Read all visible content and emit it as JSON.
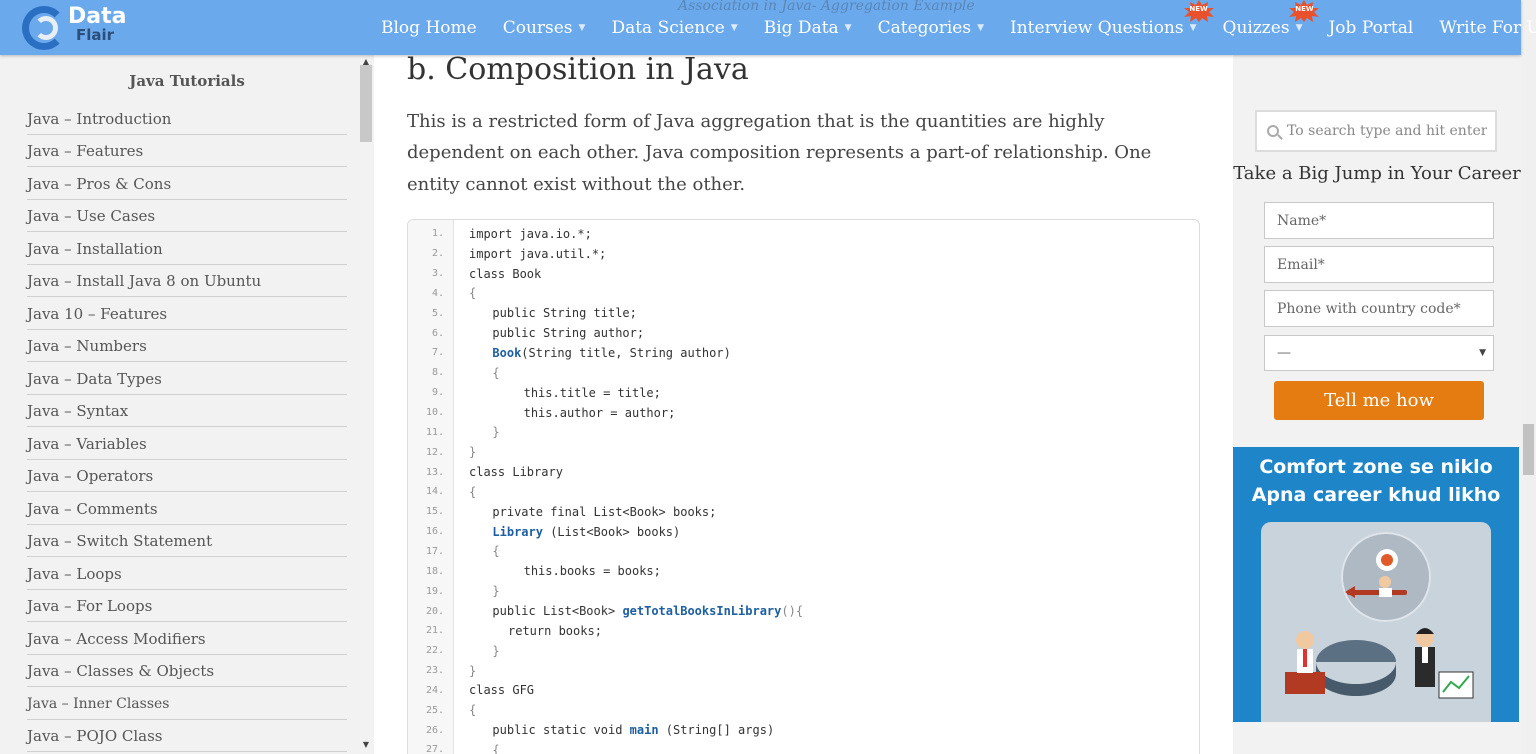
{
  "header": {
    "logo_line1": "Data",
    "logo_line2": "Flair",
    "ghost_text": "Association in Java- Aggregation Example",
    "badge_text": "NEW",
    "menu": [
      {
        "label": "Blog Home",
        "caret": false,
        "badge": false
      },
      {
        "label": "Courses",
        "caret": true,
        "badge": false
      },
      {
        "label": "Data Science",
        "caret": true,
        "badge": false
      },
      {
        "label": "Big Data",
        "caret": true,
        "badge": false
      },
      {
        "label": "Categories",
        "caret": true,
        "badge": false
      },
      {
        "label": "Interview Questions",
        "caret": true,
        "badge": true
      },
      {
        "label": "Quizzes",
        "caret": true,
        "badge": true
      },
      {
        "label": "Job Portal",
        "caret": false,
        "badge": false
      },
      {
        "label": "Write For Us",
        "caret": false,
        "badge": false
      }
    ]
  },
  "sidebar": {
    "title": "Java Tutorials",
    "items": [
      "Java – Introduction",
      "Java – Features",
      "Java – Pros & Cons",
      "Java – Use Cases",
      "Java – Installation",
      "Java – Install Java 8 on Ubuntu",
      "Java 10 – Features",
      "Java – Numbers",
      "Java – Data Types",
      "Java – Syntax",
      "Java – Variables",
      "Java – Operators",
      "Java – Comments",
      "Java – Switch Statement",
      "Java – Loops",
      "Java – For Loops",
      "Java – Access Modifiers",
      "Java – Classes & Objects",
      "Java – Inner Classes",
      "Java – POJO Class"
    ]
  },
  "article": {
    "heading": "b. Composition in Java",
    "paragraph": "This is a restricted form of Java aggregation that is the quantities are highly dependent on each other. Java composition represents a part-of relationship. One entity cannot exist without the other.",
    "code_lines": [
      {
        "n": "1.",
        "indent": 0,
        "parts": [
          [
            "import java.io.*;",
            ""
          ]
        ]
      },
      {
        "n": "2.",
        "indent": 0,
        "parts": [
          [
            "import java.util.*;",
            ""
          ]
        ]
      },
      {
        "n": "3.",
        "indent": 0,
        "parts": [
          [
            "class Book",
            ""
          ]
        ]
      },
      {
        "n": "4.",
        "indent": 0,
        "parts": [
          [
            "{",
            "dim"
          ]
        ]
      },
      {
        "n": "5.",
        "indent": 3,
        "parts": [
          [
            "public String title;",
            ""
          ]
        ]
      },
      {
        "n": "6.",
        "indent": 3,
        "parts": [
          [
            "public String author;",
            ""
          ]
        ]
      },
      {
        "n": "7.",
        "indent": 3,
        "parts": [
          [
            "Book",
            "kw"
          ],
          [
            "(String title, String author)",
            ""
          ]
        ]
      },
      {
        "n": "8.",
        "indent": 3,
        "parts": [
          [
            "{",
            "dim"
          ]
        ]
      },
      {
        "n": "9.",
        "indent": 7,
        "parts": [
          [
            "this.title = title;",
            ""
          ]
        ]
      },
      {
        "n": "10.",
        "indent": 7,
        "parts": [
          [
            "this.author = author;",
            ""
          ]
        ]
      },
      {
        "n": "11.",
        "indent": 3,
        "parts": [
          [
            "}",
            "dim"
          ]
        ]
      },
      {
        "n": "12.",
        "indent": 0,
        "parts": [
          [
            "}",
            "dim"
          ]
        ]
      },
      {
        "n": "13.",
        "indent": 0,
        "parts": [
          [
            "class Library",
            ""
          ]
        ]
      },
      {
        "n": "14.",
        "indent": 0,
        "parts": [
          [
            "{",
            "dim"
          ]
        ]
      },
      {
        "n": "15.",
        "indent": 3,
        "parts": [
          [
            "private final List<Book> books;",
            ""
          ]
        ]
      },
      {
        "n": "16.",
        "indent": 3,
        "parts": [
          [
            "Library",
            "kw"
          ],
          [
            " (List<Book> books)",
            ""
          ]
        ]
      },
      {
        "n": "17.",
        "indent": 3,
        "parts": [
          [
            "{",
            "dim"
          ]
        ]
      },
      {
        "n": "18.",
        "indent": 7,
        "parts": [
          [
            "this.books = books;",
            ""
          ]
        ]
      },
      {
        "n": "19.",
        "indent": 3,
        "parts": [
          [
            "}",
            "dim"
          ]
        ]
      },
      {
        "n": "20.",
        "indent": 3,
        "parts": [
          [
            "public List<Book> ",
            ""
          ],
          [
            "getTotalBooksInLibrary",
            "kw"
          ],
          [
            "(){",
            "dim"
          ]
        ]
      },
      {
        "n": "21.",
        "indent": 5,
        "parts": [
          [
            "return books;",
            ""
          ]
        ]
      },
      {
        "n": "22.",
        "indent": 3,
        "parts": [
          [
            "}",
            "dim"
          ]
        ]
      },
      {
        "n": "23.",
        "indent": 0,
        "parts": [
          [
            "}",
            "dim"
          ]
        ]
      },
      {
        "n": "24.",
        "indent": 0,
        "parts": [
          [
            "class GFG",
            ""
          ]
        ]
      },
      {
        "n": "25.",
        "indent": 0,
        "parts": [
          [
            "{",
            "dim"
          ]
        ]
      },
      {
        "n": "26.",
        "indent": 3,
        "parts": [
          [
            "public static void ",
            ""
          ],
          [
            "main",
            "kw"
          ],
          [
            " (String[] args)",
            ""
          ]
        ]
      },
      {
        "n": "27.",
        "indent": 3,
        "parts": [
          [
            "{",
            "dim"
          ]
        ]
      }
    ]
  },
  "right": {
    "search_placeholder": "To search type and hit enter",
    "jump_title": "Take a Big Jump in Your Career",
    "name_placeholder": "Name*",
    "email_placeholder": "Email*",
    "phone_placeholder": "Phone with country code*",
    "select_value": "—",
    "submit_label": "Tell me how",
    "promo_line1": "Comfort zone se niklo",
    "promo_line2": "Apna career khud likho"
  },
  "colors": {
    "nav_bg": "#6aa9ec",
    "accent_orange": "#e57c12",
    "promo_blue": "#1e85c8",
    "code_keyword": "#1d5fa0"
  }
}
